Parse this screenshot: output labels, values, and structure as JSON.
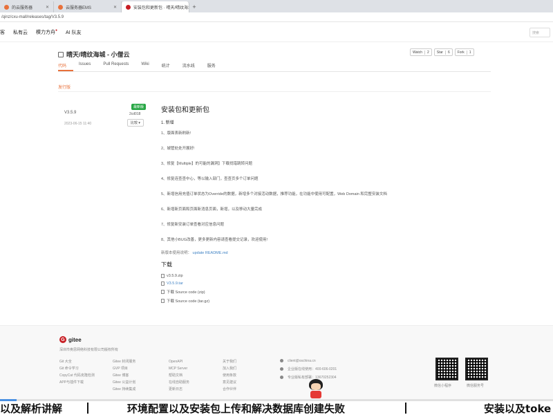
{
  "browser": {
    "tabs": [
      {
        "label": "的云服务器",
        "active": false
      },
      {
        "label": "云服务器EMS",
        "active": false
      },
      {
        "label": "安装包和更新包 · 晴天/晴纹海城",
        "active": true
      }
    ],
    "url": "/qinz/cxu-mall/releases/tag/V3.5.9"
  },
  "site_nav": {
    "items": [
      "客",
      "私有云",
      "模力方舟",
      "AI 队友"
    ],
    "hot_badge": "●",
    "search_placeholder": "搜索"
  },
  "repo": {
    "title": "晴天/晴纹海城 - 小僧云",
    "actions": [
      {
        "label": "Watch",
        "count": "2"
      },
      {
        "label": "Star",
        "count": "6"
      },
      {
        "label": "Fork",
        "count": "1"
      }
    ],
    "tabs": [
      "代码",
      "Issues",
      "Pull Requests",
      "Wiki",
      "统计",
      "流水线",
      "服务"
    ],
    "breadcrumb": "发行版"
  },
  "release": {
    "tag": "V3.5.9",
    "date": "2023-06-15 11:40",
    "badge": "最新版",
    "commit": "2cd018",
    "compare_label": "比较",
    "title": "安装包和更新包",
    "subtitle": "1. 新增",
    "lines": [
      "1、版面表新刷新!",
      "2、城管处处开展好!",
      "3、修复【Multiple】的可能的漏洞】下载找错跳转问题",
      "4、修复连查查中心，等以输入部门，查查页多个订单问题",
      "5、新增信用充值订单状态为Override的数据，新增多个对接活动数据，推荐功能，在功能中使用可配置，Web Domain 和完整安装文档",
      "6、新增新页面和页面新消息页面，新增，以及移动大量完成",
      "7、修复新安装订单查看对应信息问题",
      "8、其他小BUG改善，更多更新内容请查看提交记录，欢迎使用!"
    ],
    "note_prefix": "新版本使用说明：",
    "note_link": "update README.md",
    "download_title": "下载",
    "downloads": [
      {
        "label": "v3.5.9.zip",
        "link": false
      },
      {
        "label": "V3.5.9.tar",
        "link": true
      },
      {
        "label": "下载 Source code (zip)",
        "link": false
      },
      {
        "label": "下载 Source code (tar.gz)",
        "link": false
      }
    ]
  },
  "footer": {
    "logo_letter": "G",
    "logo_text": "gitee",
    "sub": "深圳市奥思网络科技有限公司版权所有",
    "col1": [
      "Git 大全",
      "Git 命令学习",
      "CopyCat 代码克隆检测",
      "APP与插件下载"
    ],
    "col2": [
      "Gitee 封闭服务",
      "GVP 项目",
      "Gitee 博客",
      "Gitee 公益计划",
      "Gitee 持续集成"
    ],
    "col3": [
      "OpenAPI",
      "MCP Server",
      "帮助文档",
      "在线自助服务",
      "更新日志"
    ],
    "col4": [
      "关于我们",
      "加入我们",
      "使用条款",
      "意见建议",
      "合作伙伴"
    ],
    "contact": [
      "client@oschina.cn",
      "企业版在线使用：400-606-0201",
      "专业版私有部署：13670252304"
    ],
    "qr_labels": [
      "微信小程序",
      "微信服务号"
    ]
  },
  "subtitles": {
    "left": "以及解析讲解",
    "center": "环境配置以及安装包上传和解决数据库创建失败",
    "right": "安装以及toke"
  },
  "video_progress": 0.03
}
